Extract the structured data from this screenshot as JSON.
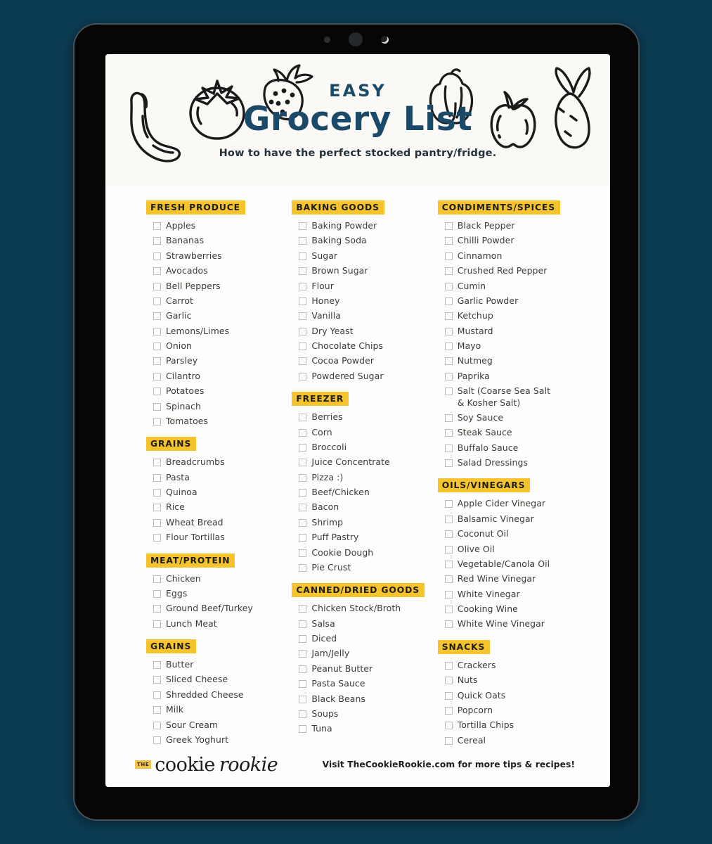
{
  "colors": {
    "background": "#0c3c54",
    "frame": "#060606",
    "paper": "#fdfdfb",
    "title_navy": "#1b4a68",
    "highlight_yellow": "#f5c32c",
    "item_text": "#3a3a38"
  },
  "device": {
    "sensors": [
      "sensor-dot-small",
      "sensor-dot-large",
      "camera-lens"
    ]
  },
  "header": {
    "eyebrow": "EASY",
    "title": "Grocery List",
    "subtitle": "How to have the perfect stocked pantry/fridge.",
    "doodles": [
      "banana-icon",
      "tomato-icon",
      "strawberry-icon",
      "bell-pepper-icon",
      "apple-icon",
      "carrot-icon"
    ]
  },
  "columns": [
    {
      "sections": [
        {
          "heading": "FRESH PRODUCE",
          "items": [
            "Apples",
            "Bananas",
            "Strawberries",
            "Avocados",
            "Bell Peppers",
            "Carrot",
            "Garlic",
            "Lemons/Limes",
            "Onion",
            "Parsley",
            "Cilantro",
            "Potatoes",
            "Spinach",
            "Tomatoes"
          ]
        },
        {
          "heading": "GRAINS",
          "items": [
            "Breadcrumbs",
            "Pasta",
            "Quinoa",
            "Rice",
            "Wheat Bread",
            "Flour Tortillas"
          ]
        },
        {
          "heading": "MEAT/PROTEIN",
          "items": [
            "Chicken",
            "Eggs",
            "Ground Beef/Turkey",
            "Lunch Meat"
          ]
        },
        {
          "heading": "GRAINS",
          "items": [
            "Butter",
            "Sliced Cheese",
            "Shredded Cheese",
            "Milk",
            "Sour Cream",
            "Greek Yoghurt"
          ]
        }
      ]
    },
    {
      "sections": [
        {
          "heading": "BAKING GOODS",
          "items": [
            "Baking Powder",
            "Baking Soda",
            "Sugar",
            "Brown Sugar",
            "Flour",
            "Honey",
            "Vanilla",
            "Dry Yeast",
            "Chocolate Chips",
            "Cocoa Powder",
            "Powdered Sugar"
          ]
        },
        {
          "heading": "FREEZER",
          "items": [
            "Berries",
            "Corn",
            "Broccoli",
            "Juice Concentrate",
            "Pizza :)",
            "Beef/Chicken",
            "Bacon",
            "Shrimp",
            "Puff Pastry",
            "Cookie Dough",
            "Pie Crust"
          ]
        },
        {
          "heading": "CANNED/DRIED GOODS",
          "items": [
            "Chicken Stock/Broth",
            "Salsa",
            "Diced",
            "Jam/Jelly",
            "Peanut Butter",
            "Pasta Sauce",
            "Black Beans",
            "Soups",
            "Tuna"
          ]
        }
      ]
    },
    {
      "sections": [
        {
          "heading": "CONDIMENTS/SPICES",
          "items": [
            "Black Pepper",
            "Chilli Powder",
            "Cinnamon",
            "Crushed Red Pepper",
            "Cumin",
            "Garlic Powder",
            "Ketchup",
            "Mustard",
            "Mayo",
            "Nutmeg",
            "Paprika",
            "Salt (Coarse Sea Salt\n& Kosher Salt)",
            "Soy Sauce",
            "Steak Sauce",
            "Buffalo Sauce",
            "Salad Dressings"
          ]
        },
        {
          "heading": "OILS/VINEGARS",
          "items": [
            "Apple Cider Vinegar",
            "Balsamic Vinegar",
            "Coconut Oil",
            "Olive Oil",
            "Vegetable/Canola Oil",
            "Red Wine Vinegar",
            "White Vinegar",
            "Cooking Wine",
            "White Wine Vinegar"
          ]
        },
        {
          "heading": "SNACKS",
          "items": [
            "Crackers",
            "Nuts",
            "Quick Oats",
            "Popcorn",
            "Tortilla Chips",
            "Cereal"
          ]
        }
      ]
    }
  ],
  "footer": {
    "brand_the": "THE",
    "brand_cookie": "cookie",
    "brand_rookie": "rookie",
    "cta": "Visit TheCookieRookie.com for more tips & recipes!"
  }
}
